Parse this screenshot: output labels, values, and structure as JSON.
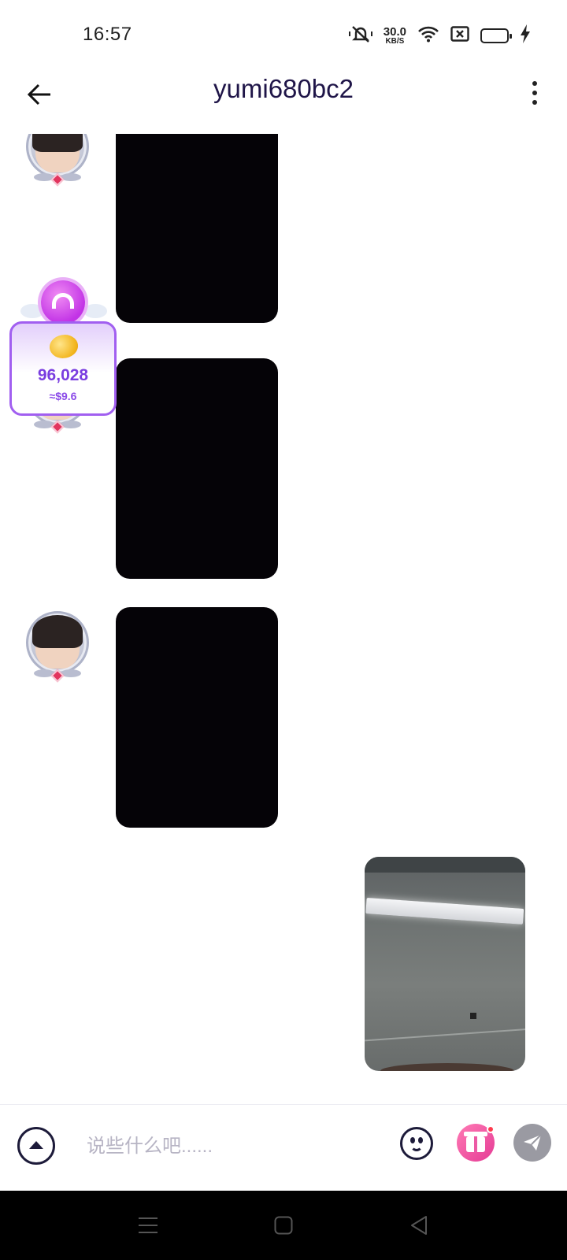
{
  "status_bar": {
    "time": "16:57",
    "net_speed": "30.0",
    "net_speed_unit": "KB/S",
    "battery_color": "#f2d66a",
    "icons": [
      "mute-icon",
      "wifi-icon",
      "sim-off-icon",
      "battery-icon",
      "charging-icon"
    ]
  },
  "header": {
    "title": "yumi680bc2",
    "back_icon": "arrow-left-icon",
    "menu_icon": "more-vertical-icon"
  },
  "gift_popup": {
    "amount": "96,028",
    "usd": "≈$9.6",
    "accent": "#a15ff0"
  },
  "messages": [
    {
      "side": "left",
      "type": "video",
      "show_avatar": true
    },
    {
      "side": "left",
      "type": "video",
      "show_avatar": true
    },
    {
      "side": "left",
      "type": "video",
      "show_avatar": true
    },
    {
      "side": "right",
      "type": "photo",
      "show_avatar": false
    }
  ],
  "composer": {
    "placeholder": "说些什么吧......",
    "icons": [
      "expand-up-icon",
      "emoji-icon",
      "gift-icon",
      "send-icon"
    ],
    "gift_accent": "#e53b95"
  },
  "nav_bar": {
    "icons": [
      "menu-icon",
      "home-icon",
      "back-icon"
    ]
  }
}
